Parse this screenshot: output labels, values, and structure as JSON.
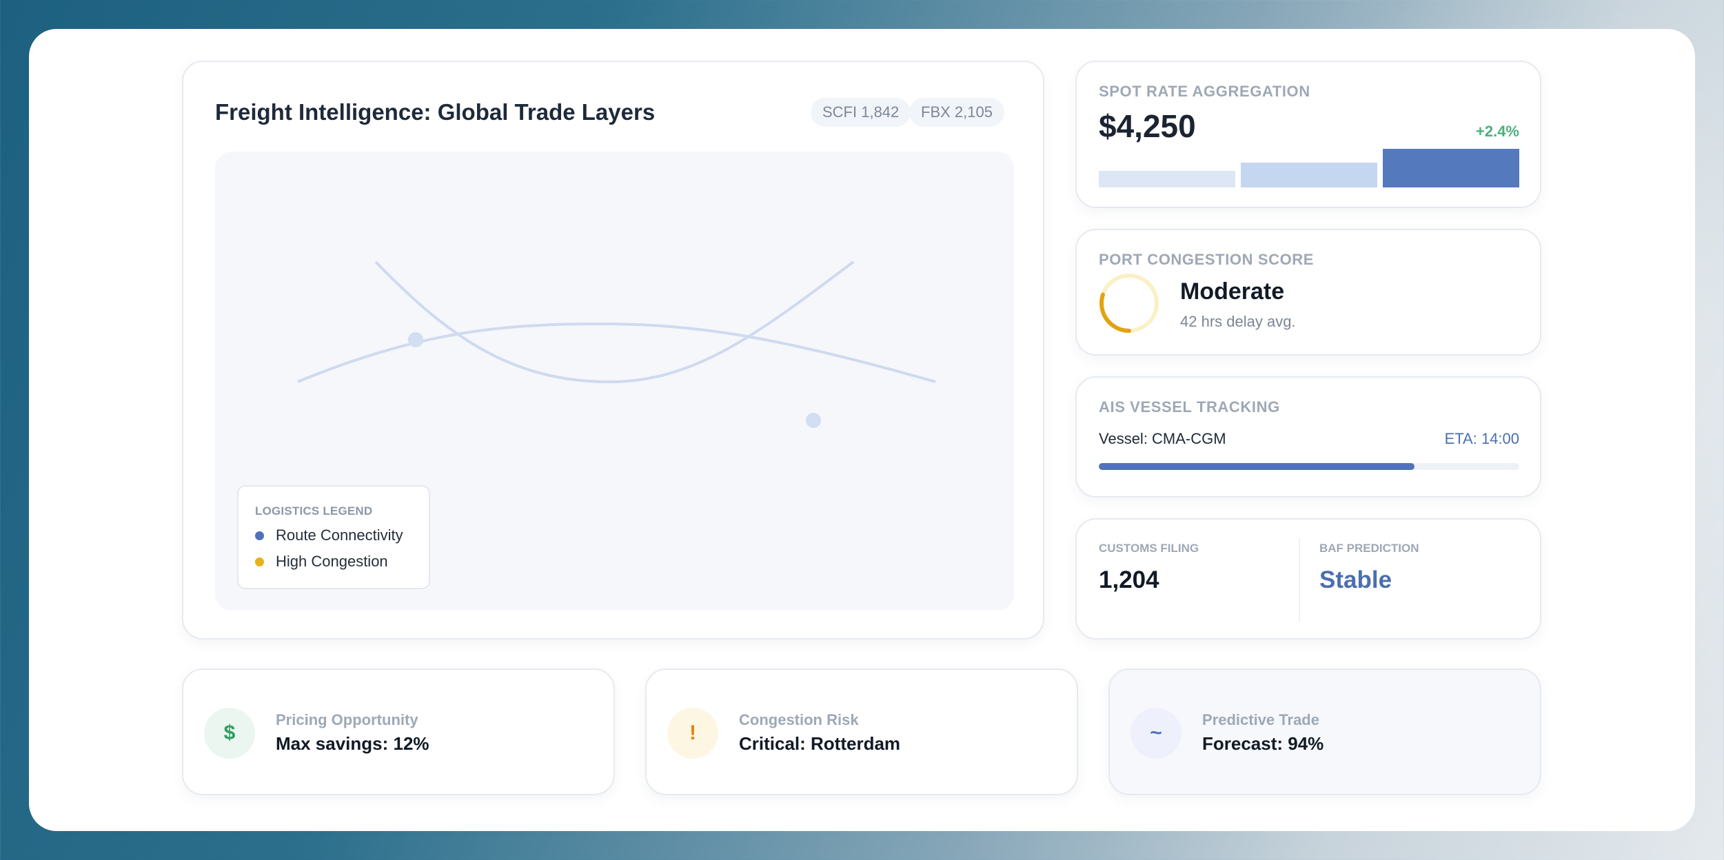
{
  "colors": {
    "accent": "#4f73b8",
    "route_line": "#cfdaf0",
    "congestion": "#e8b21b",
    "positive": "#4caf7d"
  },
  "main": {
    "title": "Freight Intelligence: Global Trade Layers",
    "index_pills": [
      "SCFI 1,842",
      "FBX 2,105"
    ],
    "legend": {
      "title": "LOGISTICS LEGEND",
      "items": [
        {
          "label": "Route Connectivity",
          "color": "#4f73b8"
        },
        {
          "label": "High Congestion",
          "color": "#e8b21b"
        }
      ]
    }
  },
  "spot_rate": {
    "label": "SPOT RATE AGGREGATION",
    "value": "$4,250",
    "change": "+2.4%",
    "bars": [
      {
        "level": 0.42,
        "color": "#dce6f5"
      },
      {
        "level": 0.64,
        "color": "#c5d6f0"
      },
      {
        "level": 1.0,
        "color": "#5479bd"
      }
    ]
  },
  "port_congestion": {
    "label": "PORT CONGESTION SCORE",
    "status": "Moderate",
    "detail": "42 hrs delay avg.",
    "ring_fraction": 0.3
  },
  "ais": {
    "label": "AIS VESSEL TRACKING",
    "vessel": "Vessel: CMA-CGM",
    "eta": "ETA: 14:00",
    "progress": 0.75
  },
  "customs": {
    "label": "CUSTOMS FILING",
    "value": "1,204"
  },
  "baf": {
    "label": "BAF PREDICTION",
    "value": "Stable"
  },
  "insights": [
    {
      "icon": "$",
      "icon_name": "dollar-icon",
      "label": "Pricing Opportunity",
      "value": "Max savings: 12%",
      "icon_color": "#2f9e5f",
      "icon_bg": "#eaf6ef"
    },
    {
      "icon": "!",
      "icon_name": "alert-icon",
      "label": "Congestion Risk",
      "value": "Critical: Rotterdam",
      "icon_color": "#e8820c",
      "icon_bg": "#fdf6e3"
    },
    {
      "icon": "~",
      "icon_name": "trend-icon",
      "label": "Predictive Trade",
      "value": "Forecast: 94%",
      "icon_color": "#4f73b8",
      "icon_bg": "#eef1fb"
    }
  ]
}
